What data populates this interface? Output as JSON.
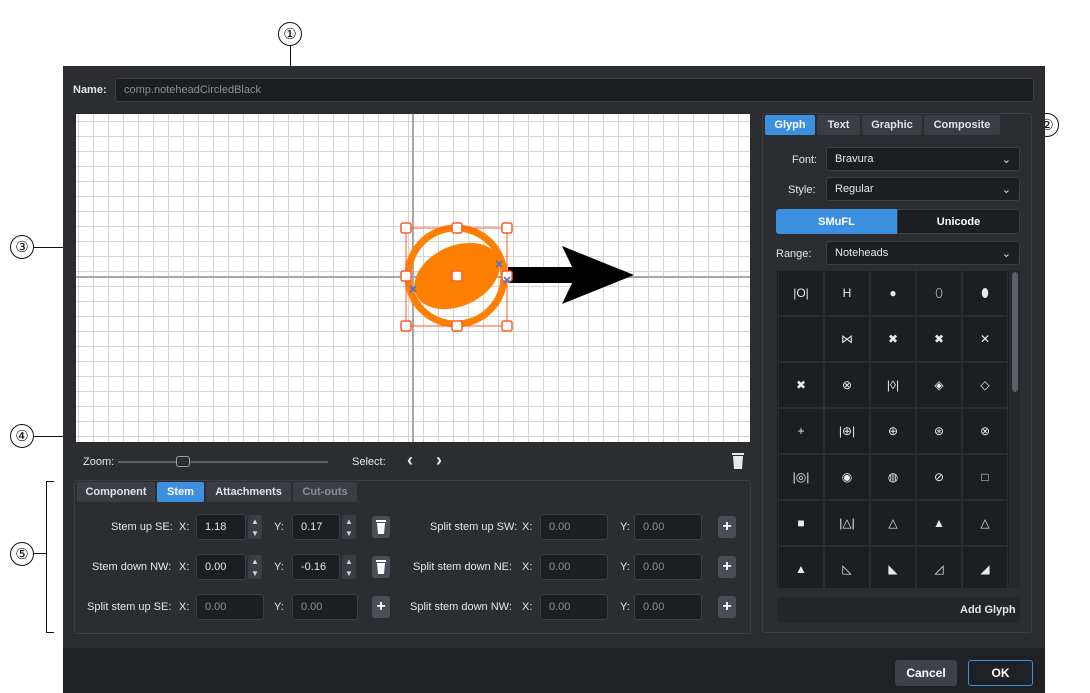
{
  "callouts": [
    "①",
    "②",
    "③",
    "④",
    "⑤"
  ],
  "name_label": "Name:",
  "name_value": "comp.noteheadCircledBlack",
  "zoom_label": "Zoom:",
  "zoom_level": 0.2,
  "select_label": "Select:",
  "prev_glyph": "‹",
  "next_glyph": "›",
  "right_tabs": [
    "Glyph",
    "Text",
    "Graphic",
    "Composite"
  ],
  "font_label": "Font:",
  "font_value": "Bravura",
  "style_label": "Style:",
  "style_value": "Regular",
  "encoding_toggle": [
    "SMuFL",
    "Unicode"
  ],
  "range_label": "Range:",
  "range_value": "Noteheads",
  "glyph_grid": [
    [
      "|O|",
      "H",
      "●",
      "⬯",
      "⬮"
    ],
    [
      "",
      "⋈",
      "✖",
      "✖",
      "✕"
    ],
    [
      "✖",
      "⊗",
      "|◊|",
      "◈",
      "◇"
    ],
    [
      "+",
      "|⊕|",
      "⊕",
      "⊛",
      "⊗"
    ],
    [
      "|◎|",
      "◉",
      "◍",
      "⊘",
      "□"
    ],
    [
      "■",
      "|△|",
      "△",
      "▲",
      "△"
    ],
    [
      "▲",
      "◺",
      "◣",
      "◿",
      "◢"
    ]
  ],
  "add_glyph_label": "Add Glyph",
  "bottom_tabs": [
    "Component",
    "Stem",
    "Attachments",
    "Cut-outs"
  ],
  "x_label": "X:",
  "y_label": "Y:",
  "rows": [
    {
      "label": "Stem up SE:",
      "x": "1.18",
      "y": "0.17",
      "split_label": "Split stem up SW:",
      "sx": "0.00",
      "sy": "0.00"
    },
    {
      "label": "Stem down NW:",
      "x": "0.00",
      "y": "-0.16",
      "split_label": "Split stem down NE:",
      "sx": "0.00",
      "sy": "0.00"
    },
    {
      "label": "Split stem up SE:",
      "x": "0.00",
      "y": "0.00",
      "split_label": "Split stem down NW:",
      "sx": "0.00",
      "sy": "0.00"
    }
  ],
  "cancel_label": "Cancel",
  "ok_label": "OK",
  "colors": {
    "accent": "#3d8fe0",
    "selection": "#ff8000",
    "handle": "#ff5a2a"
  }
}
